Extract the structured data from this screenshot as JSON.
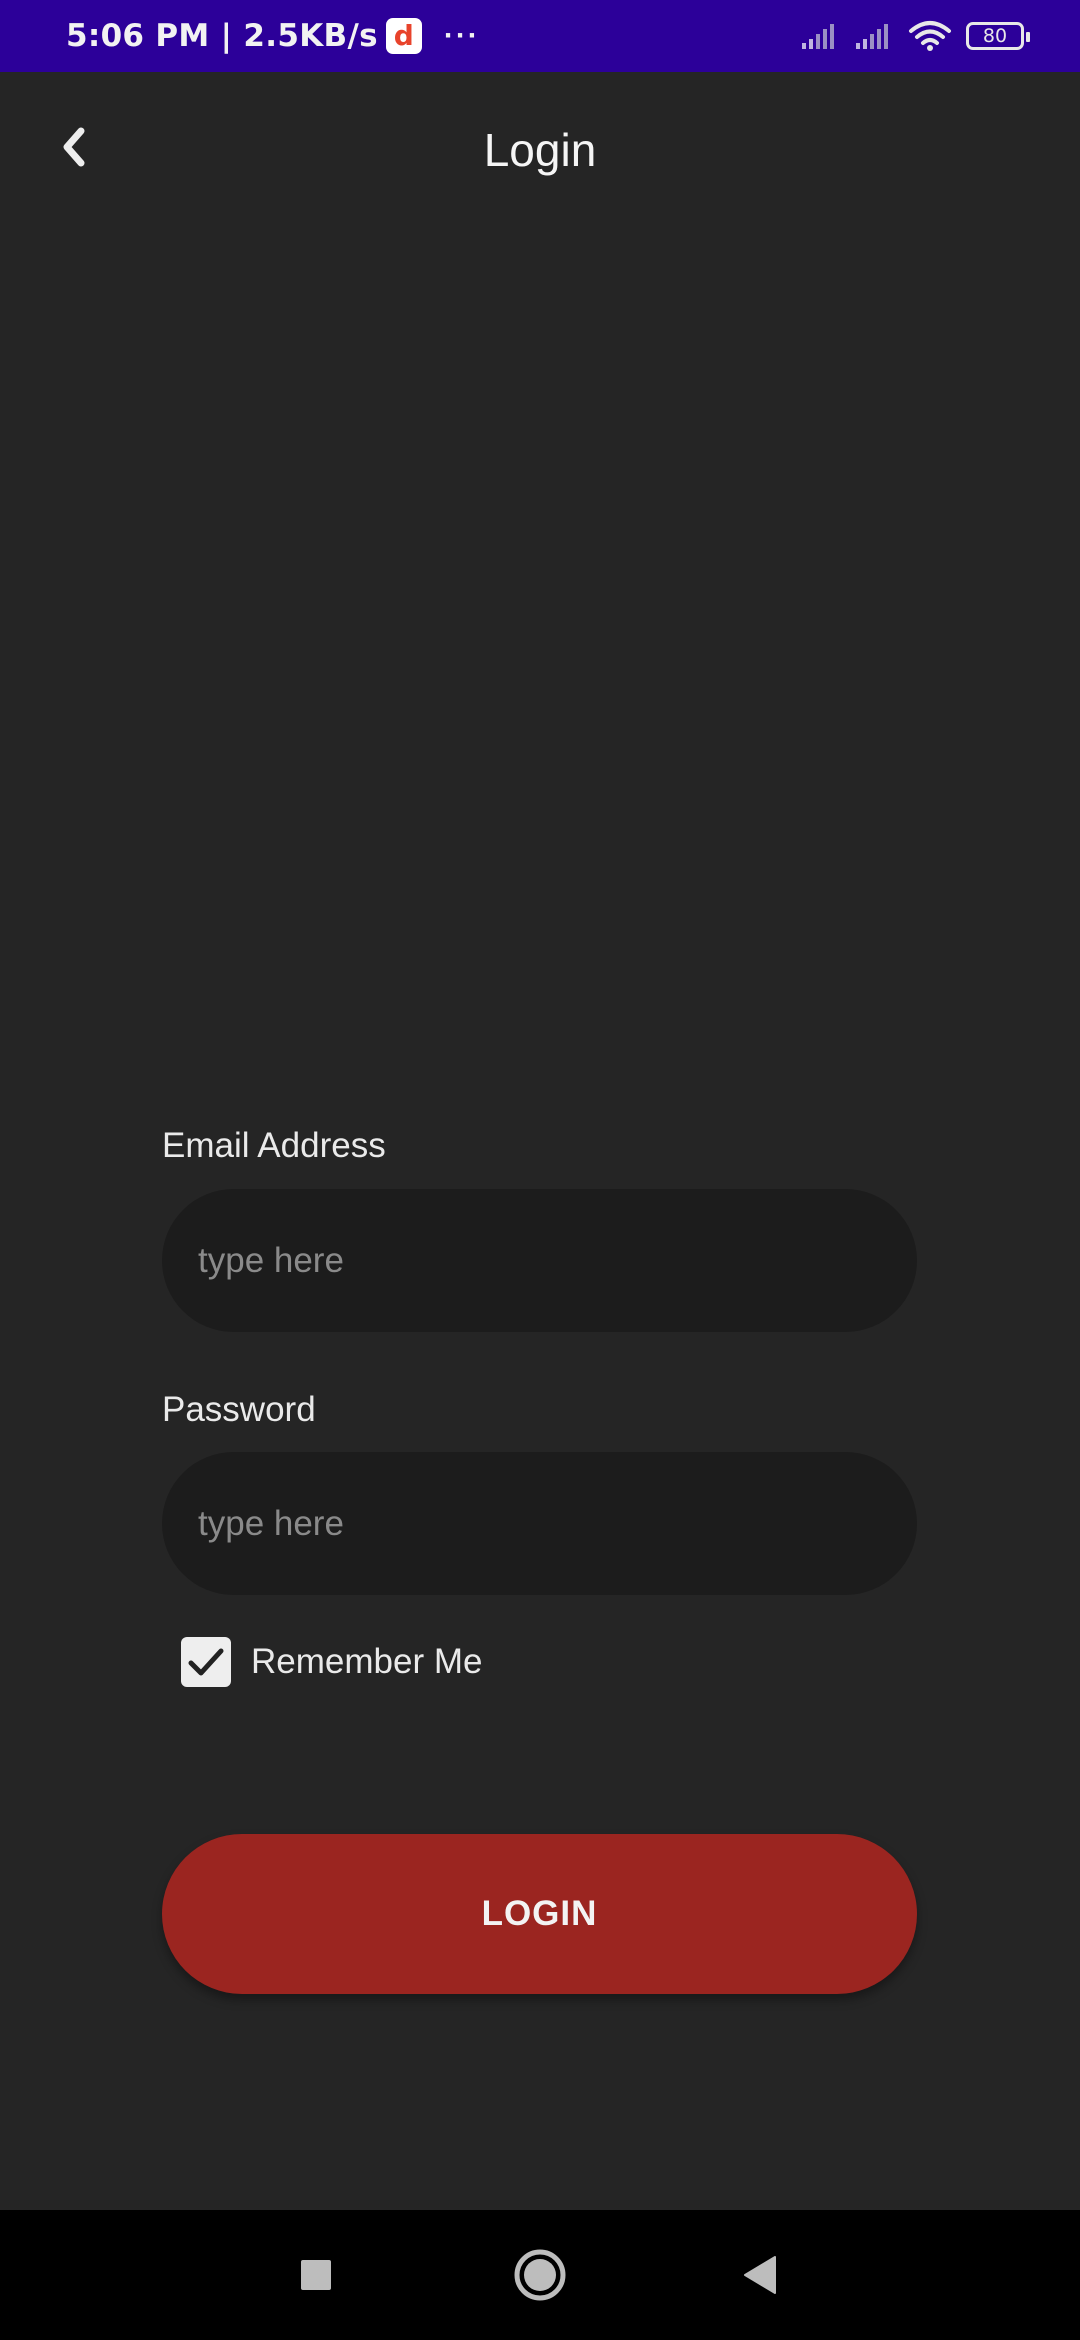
{
  "status_bar": {
    "time_speed": "5:06 PM | 2.5KB/s",
    "app_badge": "d",
    "more": "···",
    "battery": "80",
    "icons": [
      "signal-icon",
      "signal-icon",
      "wifi-icon",
      "battery-icon"
    ]
  },
  "header": {
    "back_icon": "chevron-left-icon",
    "title": "Login"
  },
  "form": {
    "email": {
      "label": "Email Address",
      "value": "",
      "placeholder": "type here"
    },
    "password": {
      "label": "Password",
      "value": "",
      "placeholder": "type here"
    },
    "remember_me": {
      "label": "Remember Me",
      "checked": true
    },
    "login_label": "LOGIN"
  },
  "colors": {
    "status_bar": "#2c0099",
    "background": "#252525",
    "input_background": "#1c1c1c",
    "button": "#9b2520"
  },
  "nav_bar": {
    "icons": [
      "recents-square-icon",
      "home-circle-icon",
      "back-triangle-icon"
    ]
  }
}
